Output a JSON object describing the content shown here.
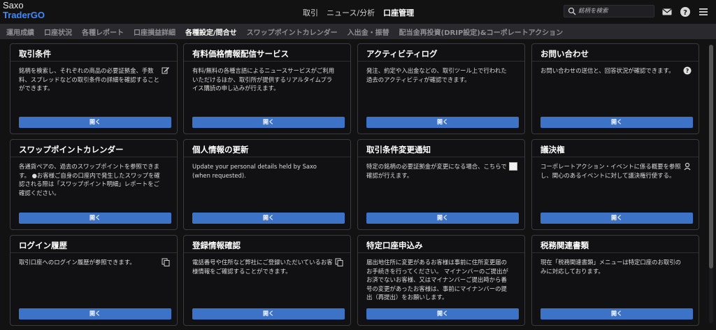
{
  "brand": {
    "line1": "Saxo",
    "line2": "TraderGO"
  },
  "top_nav": [
    {
      "label": "取引",
      "active": false
    },
    {
      "label": "ニュース/分析",
      "active": false
    },
    {
      "label": "口座管理",
      "active": true
    }
  ],
  "search": {
    "placeholder": "銘柄を検索"
  },
  "tabs": [
    {
      "label": "運用成績",
      "active": false
    },
    {
      "label": "口座状況",
      "active": false
    },
    {
      "label": "各種レポート",
      "active": false
    },
    {
      "label": "口座損益詳細",
      "active": false
    },
    {
      "label": "各種設定/問合せ",
      "active": true
    },
    {
      "label": "スワップポイントカレンダー",
      "active": false
    },
    {
      "label": "入出金・振替",
      "active": false
    },
    {
      "label": "配当金再投資(DRIP設定)&コーポレートアクション",
      "active": false
    }
  ],
  "open_label": "開く",
  "cards": [
    {
      "title": "取引条件",
      "body": "銘柄を検索し、それぞれの商品の必要証拠金、手数料、スプレッドなどの取引条件の詳細を確認することができます。",
      "icon": "edit-icon"
    },
    {
      "title": "有料価格情報配信サービス",
      "body": "有料/無料の各種言語によるニュースサービスがご利用いただけるほか、取引所が提供するリアルタイムプライス購読の申し込みが行えます。",
      "icon": ""
    },
    {
      "title": "アクティビティログ",
      "body": "発注、約定や入出金などの、取引ツール上で行われた過去のアクティビティが確認できます。",
      "icon": ""
    },
    {
      "title": "お問い合わせ",
      "body": "お問い合わせの送信と、回答状況が確認できます。",
      "icon": "question-icon"
    },
    {
      "title": "スワップポイントカレンダー",
      "body": "各通貨ペアの、過去のスワップポイントを参照できます。 ●お客様ご自身の口座内で発生したスワップを確認される際は「スワップポイント明細」レポートをご確認ください。",
      "icon": ""
    },
    {
      "title": "個人情報の更新",
      "body": "Update your personal details held by Saxo (when requested).",
      "icon": ""
    },
    {
      "title": "取引条件変更通知",
      "body": "特定の銘柄の必要証拠金が変更になる場合、こちらで確認が行えます。",
      "icon": "checkbox-icon"
    },
    {
      "title": "議決権",
      "body": "コーポレートアクション・イベントに係る概要を参照し、関心のあるイベントに対して議決権行使する。",
      "icon": "vote-icon"
    },
    {
      "title": "ログイン履歴",
      "body": "取引口座へのログイン履歴が参照できます。",
      "icon": "copy-icon"
    },
    {
      "title": "登録情報確認",
      "body": "電話番号や住所など弊社にご登録いただいているお客様情報をご確認することができます。",
      "icon": "copy-icon"
    },
    {
      "title": "特定口座申込み",
      "body": "届出地住所に変更があるお客様は事前に住所変更届のお手続きを行ってください。 マイナンバーのご提出がお済でないお客様、又はマイナンバーご提出時から番号の変更があったお客様は、事前にマイナンバーの提出（再提出）をお願いします。",
      "icon": ""
    },
    {
      "title": "税務関連書類",
      "body": "現在「税務関連書類」メニューは特定口座のお取引のみに対応しております。",
      "icon": ""
    }
  ],
  "colors": {
    "accent": "#3d73c7",
    "brand": "#3d8bff",
    "background": "#121212"
  }
}
